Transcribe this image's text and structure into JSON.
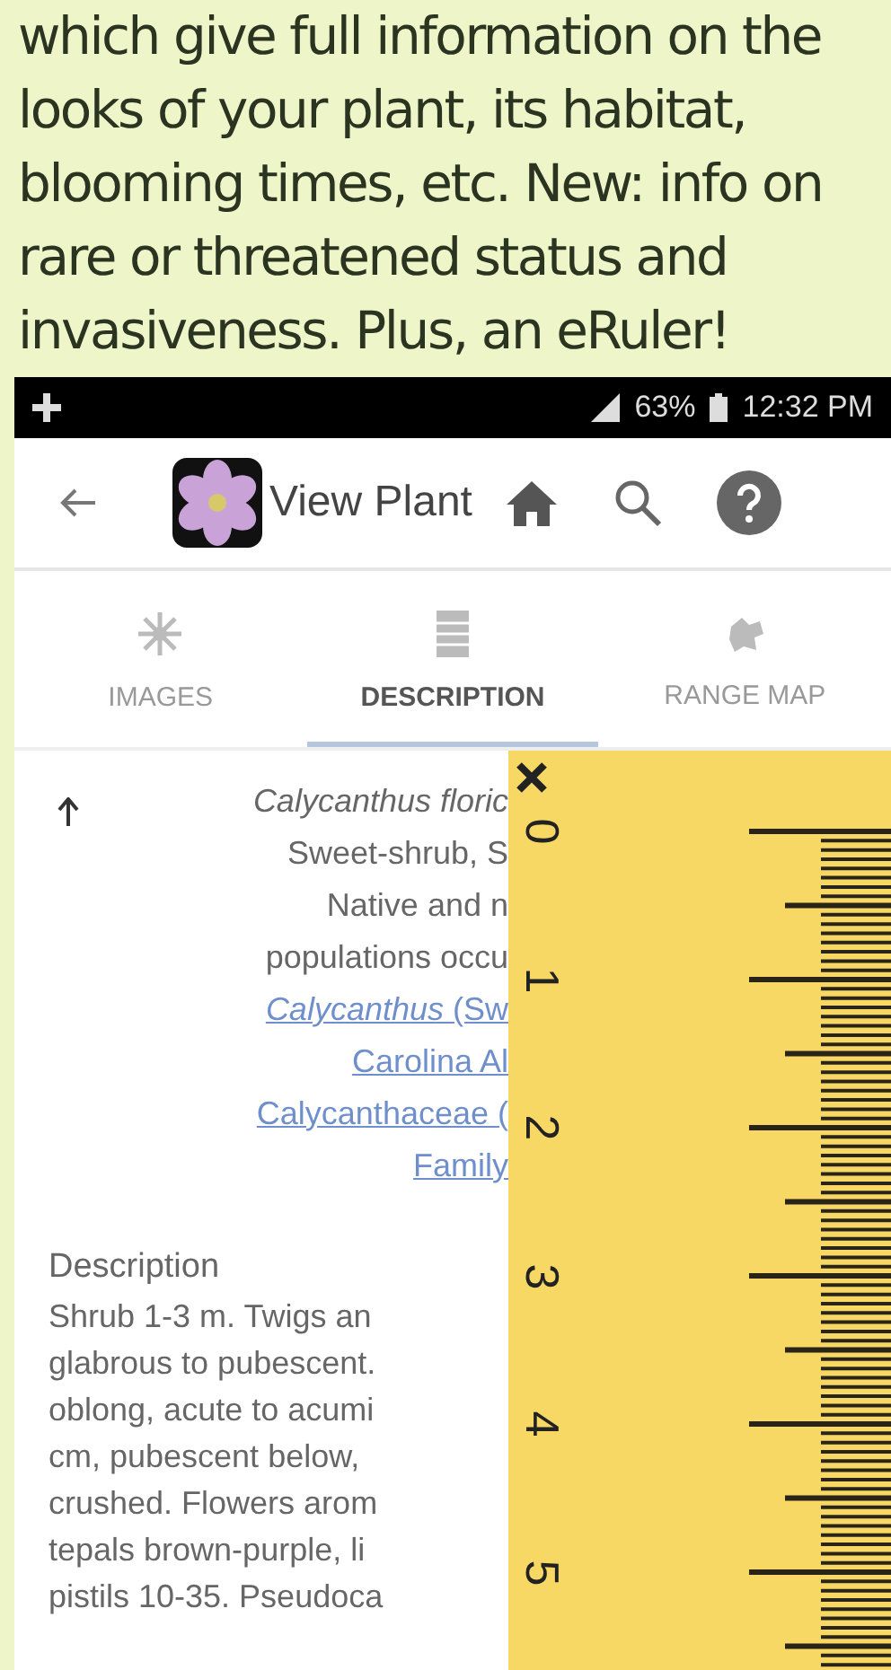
{
  "caption_lines": [
    "which give full information on the",
    "looks of your plant, its habitat,",
    "blooming times, etc. New: info on",
    "rare or threatened status and",
    "invasiveness. Plus, an eRuler!"
  ],
  "status_bar": {
    "battery": "63%",
    "time": "12:32 PM"
  },
  "app_bar": {
    "title": "View Plant"
  },
  "tabs": [
    {
      "label": "IMAGES",
      "kind": "images",
      "selected": false
    },
    {
      "label": "DESCRIPTION",
      "kind": "text",
      "selected": true
    },
    {
      "label": "RANGE MAP",
      "kind": "map",
      "selected": false
    }
  ],
  "summary": [
    {
      "text": "Calycanthus floric",
      "kind": "italic"
    },
    {
      "text": "Sweet-shrub, S",
      "kind": "plain"
    },
    {
      "text": "Native and n",
      "kind": "plain"
    },
    {
      "text": "populations occu",
      "kind": "plain"
    },
    {
      "text": "*Calycanthus* (Sw",
      "kind": "link"
    },
    {
      "text": "Carolina Al",
      "kind": "link"
    },
    {
      "text": "Calycanthaceae (",
      "kind": "link"
    },
    {
      "text": "Family",
      "kind": "link"
    }
  ],
  "description": {
    "heading": "Description",
    "lines": [
      "Shrub 1-3 m. Twigs an",
      "glabrous to pubescent.",
      "oblong, acute to acumi",
      "cm, pubescent below,",
      "crushed. Flowers arom",
      "tepals brown-purple, li",
      "pistils 10-35. Pseudoca"
    ]
  },
  "ruler": {
    "labels": [
      "0",
      "1",
      "2",
      "3",
      "4",
      "5"
    ]
  }
}
